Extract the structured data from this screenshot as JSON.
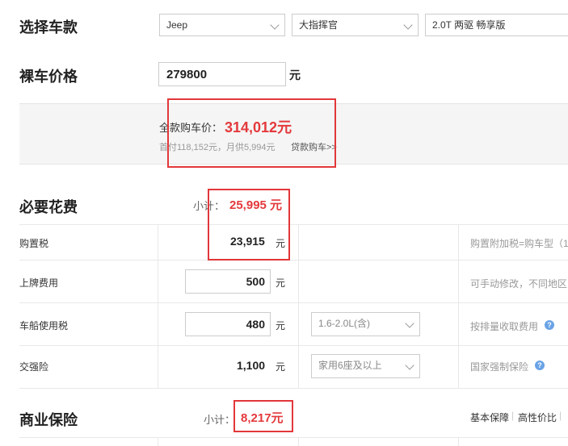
{
  "select_car": {
    "title": "选择车款",
    "brand": "Jeep",
    "model": "大指挥官",
    "version": "2.0T 两驱 畅享版"
  },
  "bare_price": {
    "title": "裸车价格",
    "value": "279800",
    "unit": "元"
  },
  "full_price": {
    "label": "全款购车价：",
    "value": "314,012元",
    "loan_info": "首付118,152元，月供5,994元",
    "loan_link": "贷款购车>>"
  },
  "required": {
    "title": "必要花费",
    "subtotal_label": "小计：",
    "subtotal_value": "25,995 元",
    "rows": [
      {
        "label": "购置税",
        "value": "23,915",
        "unit": "元",
        "note": "购置附加税=购车型（1"
      },
      {
        "label": "上牌费用",
        "value": "500",
        "unit": "元",
        "note": "可手动修改，不同地区"
      },
      {
        "label": "车船使用税",
        "value": "480",
        "unit": "元",
        "select": "1.6-2.0L(含)",
        "note": "按排量收取费用"
      },
      {
        "label": "交强险",
        "value": "1,100",
        "unit": "元",
        "select": "家用6座及以上",
        "note": "国家强制保险"
      }
    ]
  },
  "commercial": {
    "title": "商业保险",
    "subtotal_label": "小计：",
    "subtotal_value": "8,217元",
    "links": [
      "基本保障",
      "高性价比"
    ],
    "sep": "|"
  },
  "colors": {
    "accent_red": "#e4393c",
    "help_blue": "#6aa3e6"
  }
}
